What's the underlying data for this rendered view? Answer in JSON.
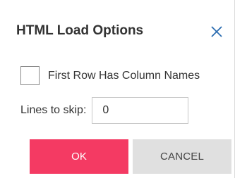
{
  "dialog": {
    "title": "HTML Load Options",
    "close_icon": "close-icon"
  },
  "options": {
    "first_row_label": "First Row Has Column Names",
    "first_row_checked": false,
    "lines_to_skip_label": "Lines to skip:",
    "lines_to_skip_value": "0"
  },
  "buttons": {
    "ok_label": "OK",
    "cancel_label": "CANCEL"
  },
  "colors": {
    "ok_bg": "#f43a63",
    "cancel_bg": "#e0e0e0",
    "close_icon": "#2b6cb0"
  }
}
